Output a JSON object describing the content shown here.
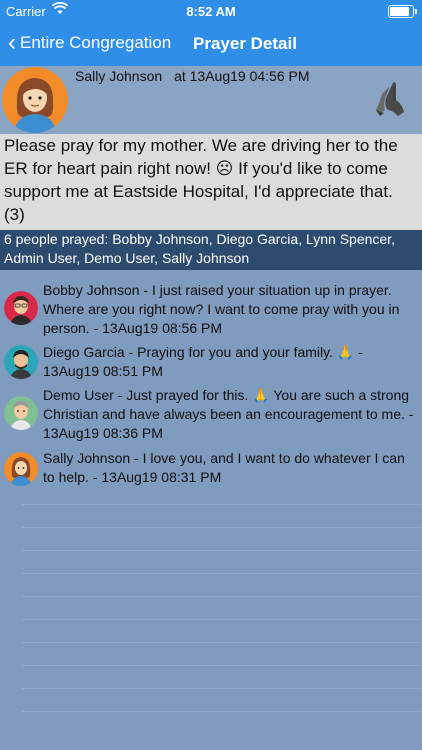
{
  "status_bar": {
    "carrier": "Carrier",
    "time": "8:52 AM",
    "battery_level": 0.95
  },
  "nav": {
    "back_label": "Entire Congregation",
    "title": "Prayer Detail"
  },
  "post": {
    "author": "Sally Johnson",
    "timestamp": "at 13Aug19 04:56 PM",
    "body": "Please pray for my mother. We are driving her to the ER for heart pain right now! ☹ If you'd like to come support me at Eastside Hospital, I'd appreciate that. (3)",
    "prayed_summary": "6 people prayed: Bobby Johnson, Diego Garcia, Lynn Spencer, Admin User, Demo User, Sally Johnson"
  },
  "comments": [
    {
      "text": "Bobby Johnson - I just raised your situation up in prayer. Where are you right now? I want to come pray with you in person. - 13Aug19 08:56 PM"
    },
    {
      "text": "Diego Garcia - Praying for you and your family. 🙏 - 13Aug19 08:51 PM"
    },
    {
      "text": "Demo User - Just prayed for this. 🙏 You are such a strong Christian and have always been an encouragement to me. - 13Aug19 08:36 PM"
    },
    {
      "text": "Sally Johnson - I love you, and I want to do whatever I can to help. - 13Aug19 08:31 PM"
    }
  ],
  "colors": {
    "nav_blue": "#2f8fe8",
    "page_bg": "#7f9bbd",
    "prayed_bar": "#2d4b6e",
    "body_bg": "#dcdcdc"
  }
}
